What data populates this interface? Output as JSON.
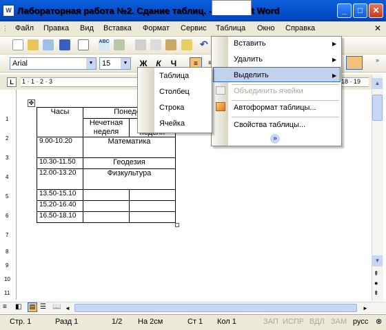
{
  "window": {
    "title": "Лабораторная работа №2. Сдание таблиц. - Microsoft Word",
    "app_icon": "W"
  },
  "menubar": [
    "Файл",
    "Правка",
    "Вид",
    "Вставка",
    "Формат",
    "Сервис",
    "Таблица",
    "Окно",
    "Справка"
  ],
  "toolbar": {
    "font": "Arial",
    "size": "15",
    "bold": "Ж",
    "italic": "К",
    "underline": "Ч"
  },
  "ruler": {
    "marks": "1 · 1 · 2 · 3",
    "right_marks": "18 · 19"
  },
  "vruler": [
    "1",
    "2",
    "3",
    "4",
    "5",
    "6",
    "7",
    "8",
    "9",
    "10",
    "11"
  ],
  "table_menu": {
    "items": [
      "Вставить",
      "Удалить",
      "Выделить",
      "Объединить ячейки",
      "Автоформат таблицы...",
      "Свойства таблицы..."
    ],
    "expand": "»"
  },
  "select_submenu": [
    "Таблица",
    "Столбец",
    "Строка",
    "Ячейка"
  ],
  "doc_table": {
    "header": [
      "Часы",
      "Понедел"
    ],
    "subheader": [
      "Нечетная неделя",
      "неделя"
    ],
    "rows": [
      [
        "9.00-10.20",
        "Математика"
      ],
      [
        "10.30-11.50",
        "Геодезия"
      ],
      [
        "12.00-13.20",
        "Физкультура"
      ],
      [
        "13.50-15.10",
        ""
      ],
      [
        "15.20-16.40",
        ""
      ],
      [
        "16.50-18.10",
        ""
      ]
    ]
  },
  "statusbar": {
    "page": "Стр. 1",
    "section": "Разд 1",
    "pages": "1/2",
    "at": "На 2см",
    "line": "Ст 1",
    "col": "Кол 1",
    "rec": "ЗАП",
    "trk": "ИСПР",
    "ext": "ВДЛ",
    "ovr": "ЗАМ",
    "lang": "русс"
  }
}
